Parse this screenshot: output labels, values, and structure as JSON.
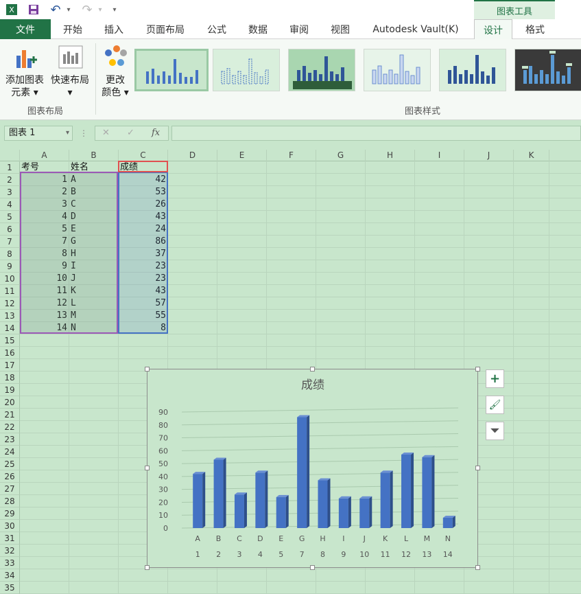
{
  "quick_access": {
    "undo": "↶",
    "redo": "↷",
    "more": "▾"
  },
  "tool_tab_title": "图表工具",
  "tabs": [
    {
      "label": "文件"
    },
    {
      "label": "开始"
    },
    {
      "label": "插入"
    },
    {
      "label": "页面布局"
    },
    {
      "label": "公式"
    },
    {
      "label": "数据"
    },
    {
      "label": "审阅"
    },
    {
      "label": "视图"
    },
    {
      "label": "Autodesk Vault(K)"
    },
    {
      "label": "设计"
    },
    {
      "label": "格式"
    }
  ],
  "ribbon": {
    "add_element_line1": "添加图表",
    "add_element_line2": "元素",
    "quick_layout": "快速布局",
    "change_color_line1": "更改",
    "change_color_line2": "颜色",
    "group_layout": "图表布局",
    "group_styles": "图表样式"
  },
  "formula_bar": {
    "name_box": "图表 1",
    "fx": "fx",
    "cancel": "✕",
    "enter": "✓"
  },
  "columns": [
    "A",
    "B",
    "C",
    "D",
    "E",
    "F",
    "G",
    "H",
    "I",
    "J",
    "K"
  ],
  "rows": [
    "1",
    "2",
    "3",
    "4",
    "5",
    "6",
    "7",
    "8",
    "9",
    "10",
    "11",
    "12",
    "13",
    "14",
    "15",
    "16",
    "17",
    "18",
    "19",
    "20",
    "21",
    "22",
    "23",
    "24",
    "25",
    "26",
    "27",
    "28",
    "29",
    "30",
    "31",
    "32",
    "33",
    "34",
    "35"
  ],
  "table": {
    "headers": [
      "考号",
      "姓名",
      "成绩"
    ],
    "rows": [
      [
        "1",
        "A",
        "42"
      ],
      [
        "2",
        "B",
        "53"
      ],
      [
        "3",
        "C",
        "26"
      ],
      [
        "4",
        "D",
        "43"
      ],
      [
        "5",
        "E",
        "24"
      ],
      [
        "7",
        "G",
        "86"
      ],
      [
        "8",
        "H",
        "37"
      ],
      [
        "9",
        "I",
        "23"
      ],
      [
        "10",
        "J",
        "23"
      ],
      [
        "11",
        "K",
        "43"
      ],
      [
        "12",
        "L",
        "57"
      ],
      [
        "13",
        "M",
        "55"
      ],
      [
        "14",
        "N",
        "8"
      ]
    ]
  },
  "chart_data": {
    "type": "bar",
    "title": "成绩",
    "categories": [
      "A",
      "B",
      "C",
      "D",
      "E",
      "G",
      "H",
      "I",
      "J",
      "K",
      "L",
      "M",
      "N"
    ],
    "secondary_categories": [
      "1",
      "2",
      "3",
      "4",
      "5",
      "7",
      "8",
      "9",
      "10",
      "11",
      "12",
      "13",
      "14"
    ],
    "values": [
      42,
      53,
      26,
      43,
      24,
      86,
      37,
      23,
      23,
      43,
      57,
      55,
      8
    ],
    "yticks": [
      "0",
      "10",
      "20",
      "30",
      "40",
      "50",
      "60",
      "70",
      "80",
      "90"
    ],
    "ylim": [
      0,
      90
    ],
    "bar_color": "#4472c4",
    "grid": true,
    "legend": "none"
  },
  "chart_buttons": {
    "add": "+",
    "style": "🖌",
    "filter": "⏷"
  },
  "colors": {
    "accent": "#217346",
    "sheet_bg": "#c8e6cc"
  }
}
